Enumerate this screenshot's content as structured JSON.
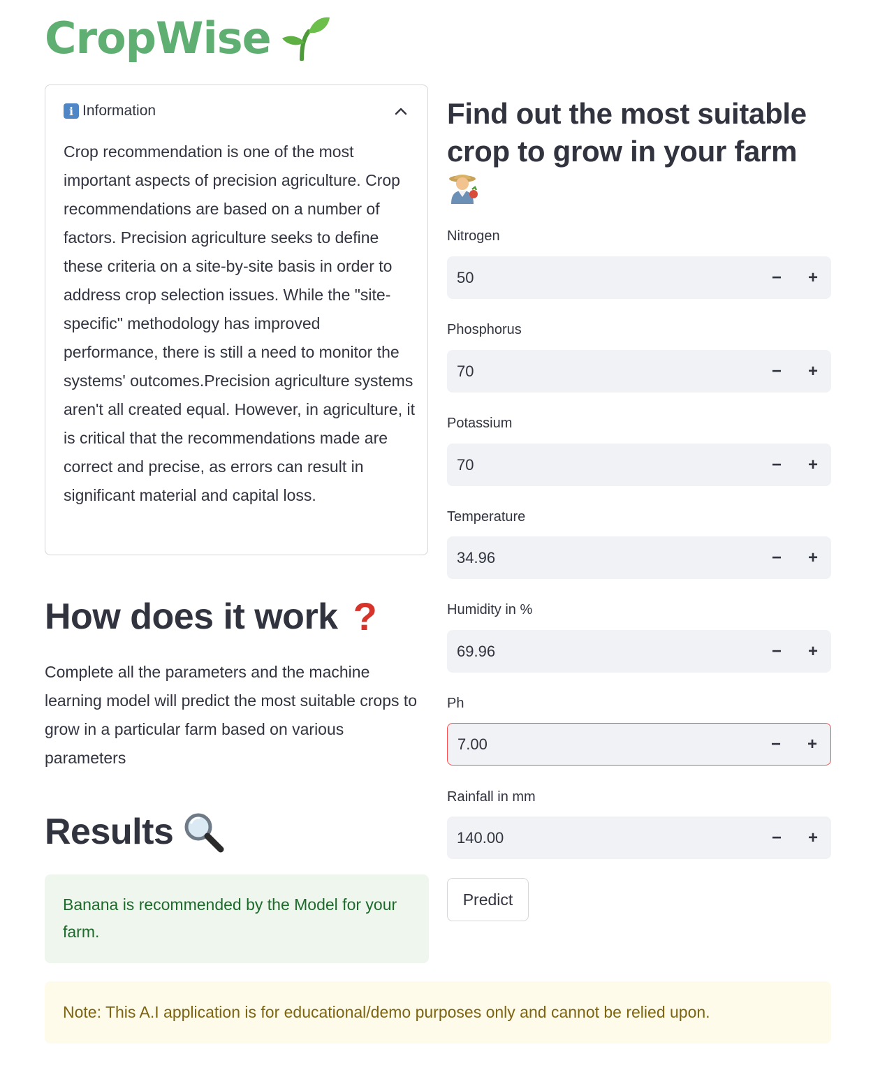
{
  "header": {
    "title": "CropWise",
    "title_color": "#5fae72",
    "title_icon": "seedling-icon"
  },
  "info_expander": {
    "icon": "info-icon",
    "label": "Information",
    "expanded": true,
    "body": "Crop recommendation is one of the most important aspects of precision agriculture. Crop recommendations are based on a number of factors. Precision agriculture seeks to define these criteria on a site-by-site basis in order to address crop selection issues. While the \"site-specific\" methodology has improved performance, there is still a need to monitor the systems' outcomes.Precision agriculture systems aren't all created equal. However, in agriculture, it is critical that the recommendations made are correct and precise, as errors can result in significant material and capital loss."
  },
  "how_section": {
    "heading": "How does it work",
    "heading_icon": "question-mark-icon",
    "body": "Complete all the parameters and the machine learning model will predict the most suitable crops to grow in a particular farm based on various parameters"
  },
  "results_section": {
    "heading": "Results",
    "heading_icon": "magnifying-glass-icon",
    "message": "Banana is recommended by the Model for your farm."
  },
  "note": {
    "text": "Note: This A.I application is for educational/demo purposes only and cannot be relied upon."
  },
  "form": {
    "heading": "Find out the most suitable crop to grow in your farm",
    "heading_icon": "farmer-icon",
    "fields": [
      {
        "label": "Nitrogen",
        "value": "50"
      },
      {
        "label": "Phosphorus",
        "value": "70"
      },
      {
        "label": "Potassium",
        "value": "70"
      },
      {
        "label": "Temperature",
        "value": "34.96"
      },
      {
        "label": "Humidity in %",
        "value": "69.96"
      },
      {
        "label": "Ph",
        "value": "7.00"
      },
      {
        "label": "Rainfall in mm",
        "value": "140.00"
      }
    ],
    "decrement_symbol": "−",
    "increment_symbol": "+",
    "submit_label": "Predict"
  },
  "colors": {
    "success_bg": "#eef6ee",
    "success_text": "#1d6b2a",
    "warning_bg": "#fffbea",
    "warning_text": "#7d6410",
    "focus_border": "#ff4b4b",
    "input_bg": "#f0f2f6"
  }
}
